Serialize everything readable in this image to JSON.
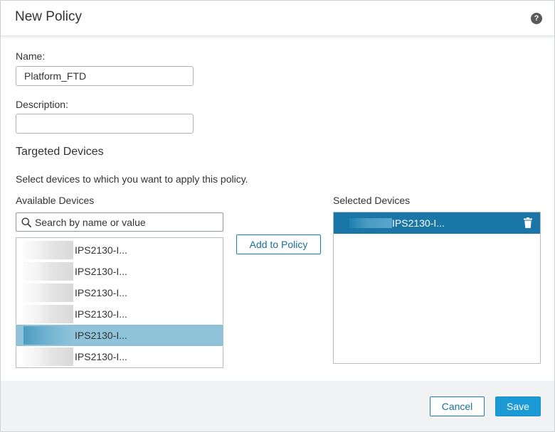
{
  "dialog": {
    "title": "New Policy",
    "help_icon": "help-icon",
    "help_glyph": "?"
  },
  "form": {
    "name_label": "Name:",
    "name_value": "Platform_FTD",
    "description_label": "Description:",
    "description_value": ""
  },
  "targeted": {
    "title": "Targeted Devices",
    "instructions": "Select devices to which you want to apply this policy.",
    "available_label": "Available Devices",
    "selected_label": "Selected Devices",
    "search_placeholder": "Search by name or value",
    "search_icon": "search-icon",
    "add_button": "Add to Policy",
    "available_devices": [
      {
        "name": "IPS2130-I...",
        "selected": false
      },
      {
        "name": "IPS2130-I...",
        "selected": false
      },
      {
        "name": "IPS2130-I...",
        "selected": false
      },
      {
        "name": "IPS2130-I...",
        "selected": false
      },
      {
        "name": "IPS2130-I...",
        "selected": true
      },
      {
        "name": "IPS2130-I...",
        "selected": false
      }
    ],
    "selected_devices": [
      {
        "name": "IPS2130-I...",
        "remove_icon": "trash-icon"
      }
    ]
  },
  "footer": {
    "cancel": "Cancel",
    "save": "Save"
  },
  "colors": {
    "accent": "#1b9ad6",
    "selected_row": "#1a76a6",
    "highlight_row": "#8fc3da",
    "footer_bg": "#f1f2f3"
  }
}
